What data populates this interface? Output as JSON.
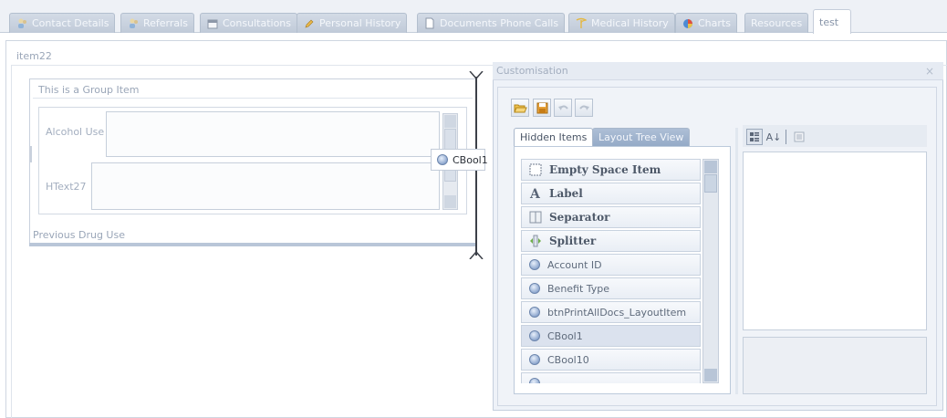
{
  "tabs": [
    {
      "label": "Contact Details",
      "icon": "people-icon"
    },
    {
      "label": "Referrals",
      "icon": "people-icon"
    },
    {
      "label": "Consultations",
      "icon": "calendar-icon"
    },
    {
      "label": "Personal History",
      "icon": "pencil-icon"
    },
    {
      "label": "Documents Phone Calls",
      "icon": "document-icon"
    },
    {
      "label": "Medical History",
      "icon": "caduceus-icon"
    },
    {
      "label": "Charts",
      "icon": "pie-chart-icon"
    },
    {
      "label": "Resources",
      "icon": ""
    },
    {
      "label": "test",
      "icon": ""
    }
  ],
  "layout": {
    "item_header": "item22",
    "group_title": "This is a Group Item",
    "rows": [
      {
        "label": "Alcohol Use"
      },
      {
        "label": "HText27"
      }
    ],
    "previous_drug_use": "Previous Drug Use",
    "drag_item": "CBool1"
  },
  "customisation": {
    "title": "Customisation",
    "close": "×",
    "tabs": [
      "Hidden Items",
      "Layout Tree View"
    ],
    "items": [
      {
        "label": "Empty Space Item",
        "icon": "empty-space-icon",
        "bold": true
      },
      {
        "label": "Label",
        "icon": "label-icon",
        "bold": true
      },
      {
        "label": "Separator",
        "icon": "separator-icon",
        "bold": true
      },
      {
        "label": "Splitter",
        "icon": "splitter-icon",
        "bold": true
      },
      {
        "label": "Account ID",
        "icon": "bool-icon",
        "bold": false
      },
      {
        "label": "Benefit Type",
        "icon": "bool-icon",
        "bold": false
      },
      {
        "label": "btnPrintAllDocs_LayoutItem",
        "icon": "bool-icon",
        "bold": false
      },
      {
        "label": "CBool1",
        "icon": "bool-icon",
        "bold": false,
        "selected": true
      },
      {
        "label": "CBool10",
        "icon": "bool-icon",
        "bold": false
      },
      {
        "label": "",
        "icon": "bool-icon",
        "bold": false
      }
    ]
  }
}
